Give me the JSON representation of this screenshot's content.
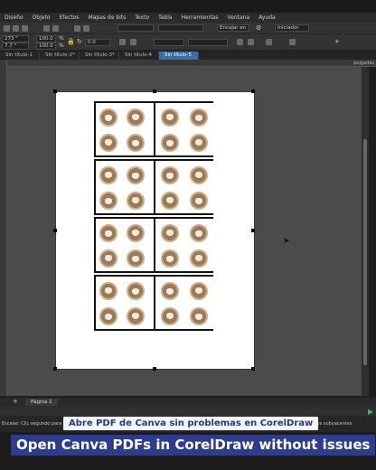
{
  "menu": [
    "Diseño",
    "Objeto",
    "Efectos",
    "Mapas de bits",
    "Texto",
    "Tabla",
    "Herramientas",
    "Ventana",
    "Ayuda"
  ],
  "toolbar": {
    "x": "273 \"",
    "y": "7.7 \"",
    "width_pct": "100.0",
    "height_pct": "100.0",
    "percent": "%",
    "rotation": "0.0",
    "snap_label": "Encajar en",
    "launcher_label": "Iniciador"
  },
  "tabs": [
    "Sin título-1",
    "Sin título-2*",
    "Sin título-3*",
    "Sin título-4",
    "Sin título-5"
  ],
  "active_tab": 4,
  "ruler_unit": "pulgadas",
  "pagebar": {
    "add": "+",
    "page": "Página 1"
  },
  "status": {
    "left": "Escalar: Clic segundo para Girar...",
    "right": "objetos subyacentes"
  },
  "captions": {
    "spanish": "Abre PDF de Canva sin problemas en CorelDraw",
    "english": "Open Canva PDFs in CorelDraw without issues"
  },
  "icons": [
    "arrow-cursor-icon",
    "play-icon",
    "lock-icon",
    "gear-icon"
  ]
}
